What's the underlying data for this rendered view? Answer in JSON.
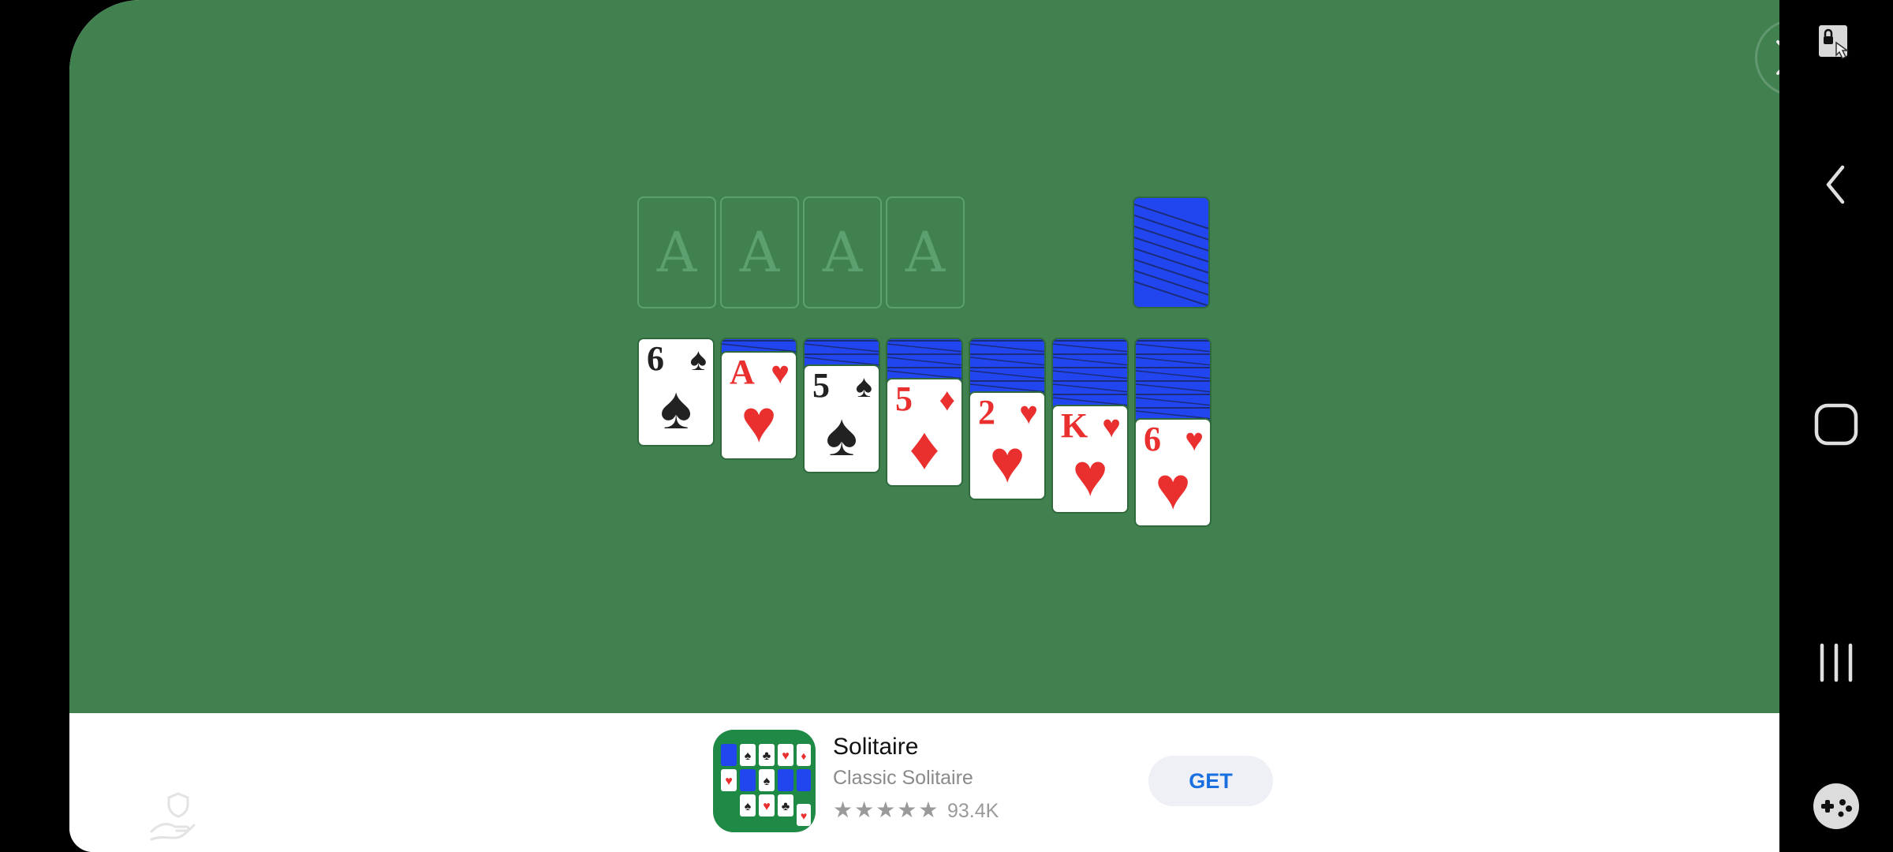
{
  "game": {
    "foundations": [
      "A",
      "A",
      "A",
      "A"
    ],
    "stock_icon": "card-back",
    "tableau": [
      {
        "rank": "6",
        "suit": "♠",
        "color": "black",
        "hidden": 0
      },
      {
        "rank": "A",
        "suit": "♥",
        "color": "red",
        "hidden": 1
      },
      {
        "rank": "5",
        "suit": "♠",
        "color": "black",
        "hidden": 2
      },
      {
        "rank": "5",
        "suit": "♦",
        "color": "red",
        "hidden": 3
      },
      {
        "rank": "2",
        "suit": "♥",
        "color": "red",
        "hidden": 4
      },
      {
        "rank": "K",
        "suit": "♥",
        "color": "red",
        "hidden": 5
      },
      {
        "rank": "6",
        "suit": "♥",
        "color": "red",
        "hidden": 6
      }
    ]
  },
  "ad": {
    "app_name": "Solitaire",
    "app_subtitle": "Classic Solitaire",
    "stars": "★★★★★",
    "rating_count": "93.4K",
    "get_label": "GET"
  },
  "colors": {
    "felt": "#418150",
    "card_back": "#2146f0",
    "red_suit": "#ea2f2f",
    "get_text": "#1a6fe0"
  },
  "icons": {
    "close": "close-icon",
    "nav": [
      "screen-lock-icon",
      "back-icon",
      "home-icon",
      "recents-icon",
      "game-tools-icon"
    ],
    "privacy": "privacy-hand-icon"
  }
}
